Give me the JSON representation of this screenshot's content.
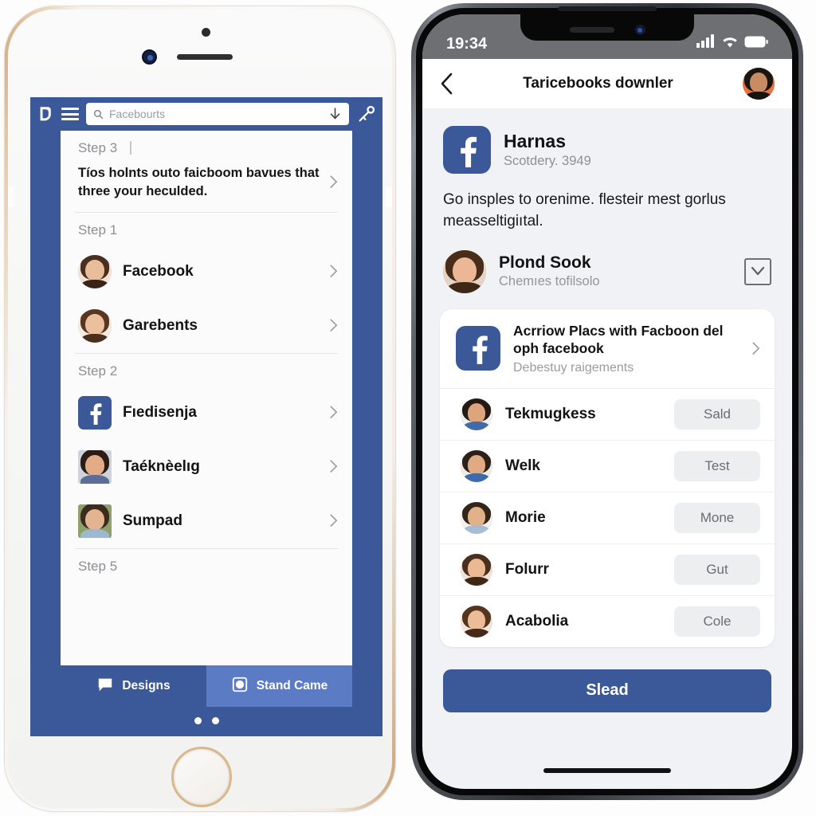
{
  "left_phone": {
    "device": "iphone-home-button",
    "topbar": {
      "logo_icon": "facebook-logo-icon",
      "menu_icon": "hamburger-menu-icon",
      "search_icon": "search-icon",
      "search_placeholder": "Facebourts",
      "download_icon": "download-arrow-icon",
      "key_icon": "key-icon"
    },
    "sections": [
      {
        "step_label": "Step 3",
        "has_cursor": true,
        "promo": {
          "text": "Tíos holnts outo faicboom bavues that three your heculded.",
          "chevron_icon": "chevron-right-icon"
        }
      },
      {
        "step_label": "Step 1",
        "rows": [
          {
            "name": "Facebook",
            "avatar": "woman-avatar-1",
            "chevron_icon": "chevron-right-icon"
          },
          {
            "name": "Garebents",
            "avatar": "woman-avatar-2",
            "chevron_icon": "chevron-right-icon"
          }
        ]
      },
      {
        "step_label": "Step 2",
        "rows": [
          {
            "name": "Fıedisenja",
            "avatar": "facebook-app-icon",
            "chevron_icon": "chevron-right-icon"
          },
          {
            "name": "Taéknèelıg",
            "avatar": "man-avatar-1",
            "chevron_icon": "chevron-right-icon"
          },
          {
            "name": "Sumpad",
            "avatar": "man-avatar-2",
            "chevron_icon": "chevron-right-icon"
          }
        ]
      },
      {
        "step_label": "Step 5",
        "rows": []
      }
    ],
    "tabs": [
      {
        "label": "Designs",
        "icon": "chat-bubble-icon",
        "active": false
      },
      {
        "label": "Stand Came",
        "icon": "camera-shutter-icon",
        "active": true
      }
    ],
    "page_dots": 2
  },
  "right_phone": {
    "device": "iphone-notch",
    "statusbar": {
      "time": "19:34",
      "signal_icon": "cellular-signal-icon",
      "wifi_icon": "wifi-icon",
      "battery_icon": "battery-icon"
    },
    "navbar": {
      "back_icon": "chevron-left-icon",
      "title": "Taricebooks downler",
      "avatar": "profile-avatar"
    },
    "app_header": {
      "icon": "facebook-app-icon",
      "title": "Harnas",
      "subtitle": "Scotdery. 3949"
    },
    "description": "Go insples to orenime. flesteir mest gorlus measseltigiıtal.",
    "person": {
      "avatar": "woman-avatar-3",
      "name": "Plond Sook",
      "subtitle": "Chemıes tofilsolo",
      "checkbox_icon": "checkbox-chevron-down-icon"
    },
    "card": {
      "header": {
        "icon": "facebook-app-icon",
        "title": "Acrriow Placs with Facboon del oph facebook",
        "subtitle": "Debestuy raigements",
        "chevron_icon": "chevron-right-icon"
      },
      "rows": [
        {
          "name": "Tekmugkess",
          "button": "Sald",
          "avatar": "man-avatar-3"
        },
        {
          "name": "Welk",
          "button": "Test",
          "avatar": "man-avatar-4"
        },
        {
          "name": "Morie",
          "button": "Mone",
          "avatar": "man-avatar-5"
        },
        {
          "name": "Folurr",
          "button": "Gut",
          "avatar": "woman-avatar-4"
        },
        {
          "name": "Acabolia",
          "button": "Cole",
          "avatar": "woman-avatar-5"
        }
      ]
    },
    "cta": {
      "label": "Slead"
    }
  },
  "colors": {
    "facebook_blue": "#3b5998",
    "facebook_blue_light": "#5b7bc4",
    "page_bg": "#f1f2f5",
    "button_grey": "#eceef0",
    "text_primary": "#131313",
    "text_muted": "#9a9ca1"
  }
}
